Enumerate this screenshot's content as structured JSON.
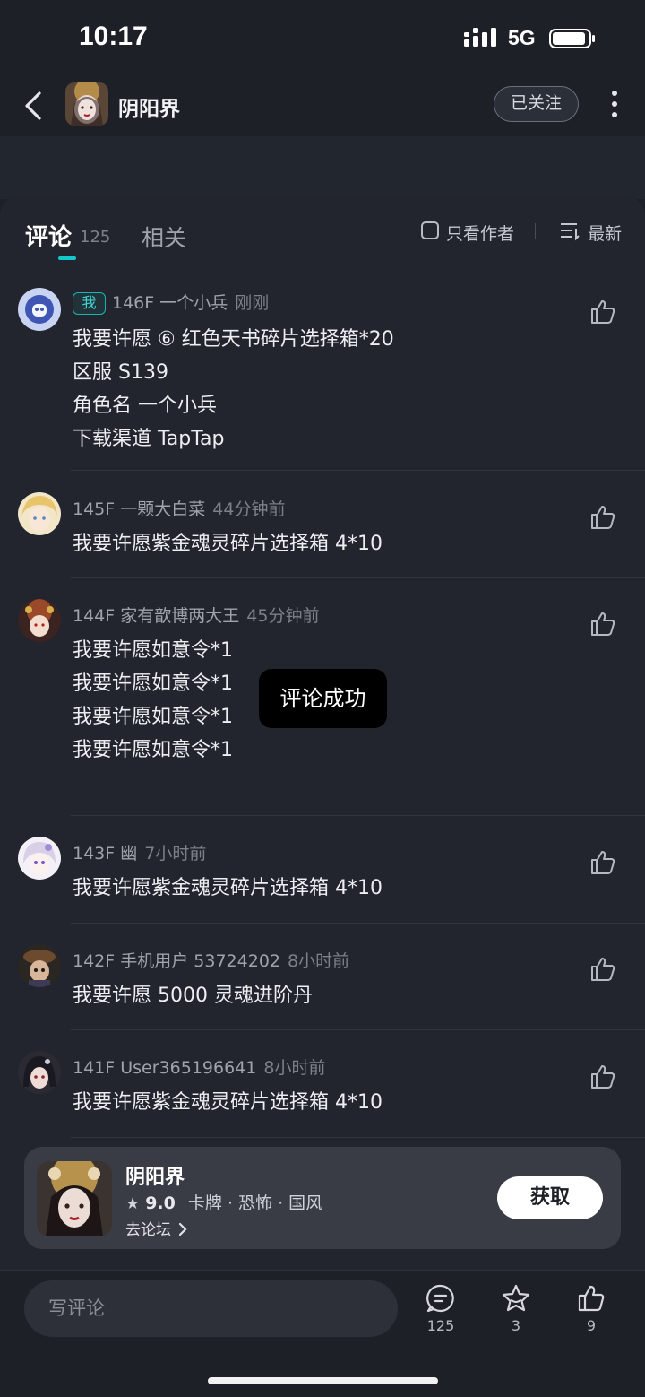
{
  "status_bar": {
    "time": "10:17",
    "network": "5G"
  },
  "header": {
    "title": "阴阳界",
    "follow_label": "已关注"
  },
  "tabs": {
    "comments_label": "评论",
    "comments_count": "125",
    "related_label": "相关",
    "author_only_label": "只看作者",
    "sort_label": "最新"
  },
  "comments": [
    {
      "floor": "146F",
      "user": "一个小兵",
      "time": "刚刚",
      "badge": "我",
      "lines": [
        "我要许愿 ⑥ 红色天书碎片选择箱*20",
        "区服 S139",
        "角色名 一个小兵",
        "下载渠道 TapTap"
      ]
    },
    {
      "floor": "145F",
      "user": "一颗大白菜",
      "time": "44分钟前",
      "lines": [
        "我要许愿紫金魂灵碎片选择箱 4*10"
      ]
    },
    {
      "floor": "144F",
      "user": "家有歆博两大王",
      "time": "45分钟前",
      "lines": [
        "我要许愿如意令*1",
        "我要许愿如意令*1",
        "我要许愿如意令*1",
        "我要许愿如意令*1"
      ]
    },
    {
      "floor": "143F",
      "user": "幽",
      "time": "7小时前",
      "lines": [
        "我要许愿紫金魂灵碎片选择箱 4*10"
      ]
    },
    {
      "floor": "142F",
      "user": "手机用户 53724202",
      "time": "8小时前",
      "lines": [
        "我要许愿 5000 灵魂进阶丹"
      ]
    },
    {
      "floor": "141F",
      "user": "User365196641",
      "time": "8小时前",
      "lines": [
        "我要许愿紫金魂灵碎片选择箱 4*10"
      ]
    }
  ],
  "toast": "评论成功",
  "game_card": {
    "name": "阴阳界",
    "rating": "9.0",
    "tags": "卡牌 · 恐怖 · 国风",
    "forum_link": "去论坛",
    "get_label": "获取"
  },
  "bottom_bar": {
    "placeholder": "写评论",
    "comment_count": "125",
    "favorite_count": "3",
    "like_count": "9"
  },
  "colors": {
    "accent": "#14c9c9",
    "background": "#1d2027",
    "panel": "#22252d"
  }
}
